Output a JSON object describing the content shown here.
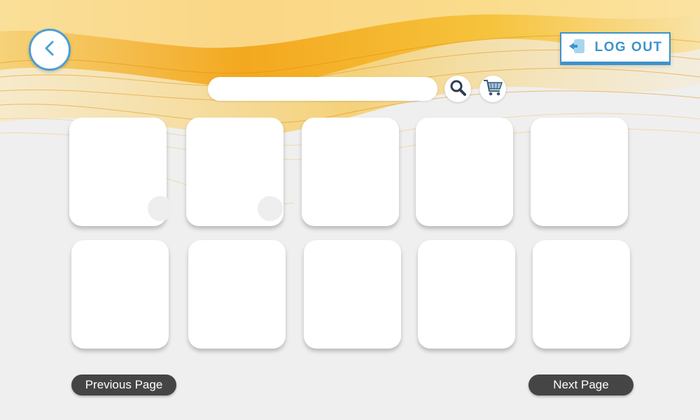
{
  "header": {
    "logout_label": "LOG OUT"
  },
  "search": {
    "value": "",
    "placeholder": ""
  },
  "icons": {
    "back": "chevron-left-icon",
    "logout": "logout-icon",
    "search": "search-icon",
    "cart": "shopping-cart-icon"
  },
  "tiles": [
    {
      "row": 1,
      "col": 1
    },
    {
      "row": 1,
      "col": 2
    },
    {
      "row": 1,
      "col": 3
    },
    {
      "row": 1,
      "col": 4
    },
    {
      "row": 1,
      "col": 5
    },
    {
      "row": 2,
      "col": 1
    },
    {
      "row": 2,
      "col": 2
    },
    {
      "row": 2,
      "col": 3
    },
    {
      "row": 2,
      "col": 4
    },
    {
      "row": 2,
      "col": 5
    }
  ],
  "pagination": {
    "previous_label": "Previous Page",
    "next_label": "Next Page"
  },
  "colors": {
    "accent": "#3d93cc",
    "background": "#efefef",
    "wave_orange": "#f2a20c",
    "wave_yellow": "#f7c948",
    "page_button": "#454545"
  }
}
